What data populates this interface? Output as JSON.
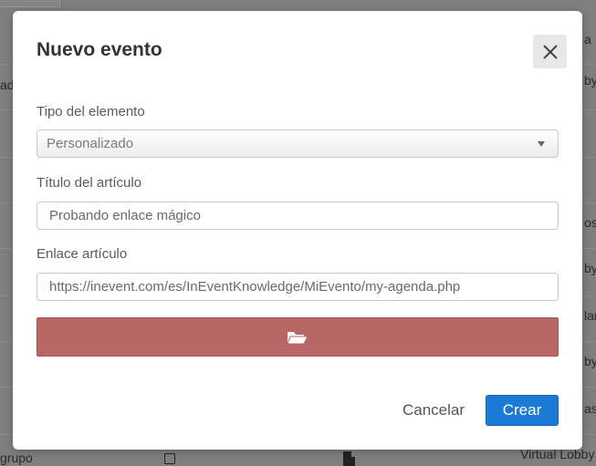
{
  "background": {
    "fragments_left": [
      "ad"
    ],
    "fragments_right": [
      "a",
      "by",
      "os",
      "by",
      "lan",
      "by",
      "as"
    ],
    "bottom_left": "grupo",
    "bottom_right": "Virtual Lobby"
  },
  "modal": {
    "title": "Nuevo evento",
    "close_icon": "close-icon",
    "type_field": {
      "label": "Tipo del elemento",
      "selected": "Personalizado"
    },
    "title_field": {
      "label": "Título del artículo",
      "value": "Probando enlace mágico"
    },
    "link_field": {
      "label": "Enlace artículo",
      "value": "https://inevent.com/es/InEventKnowledge/MiEvento/my-agenda.php"
    },
    "upload_icon": "folder-open-icon",
    "cancel_label": "Cancelar",
    "create_label": "Crear"
  },
  "colors": {
    "primary": "#1a7ad4",
    "upload": "#b86666"
  }
}
